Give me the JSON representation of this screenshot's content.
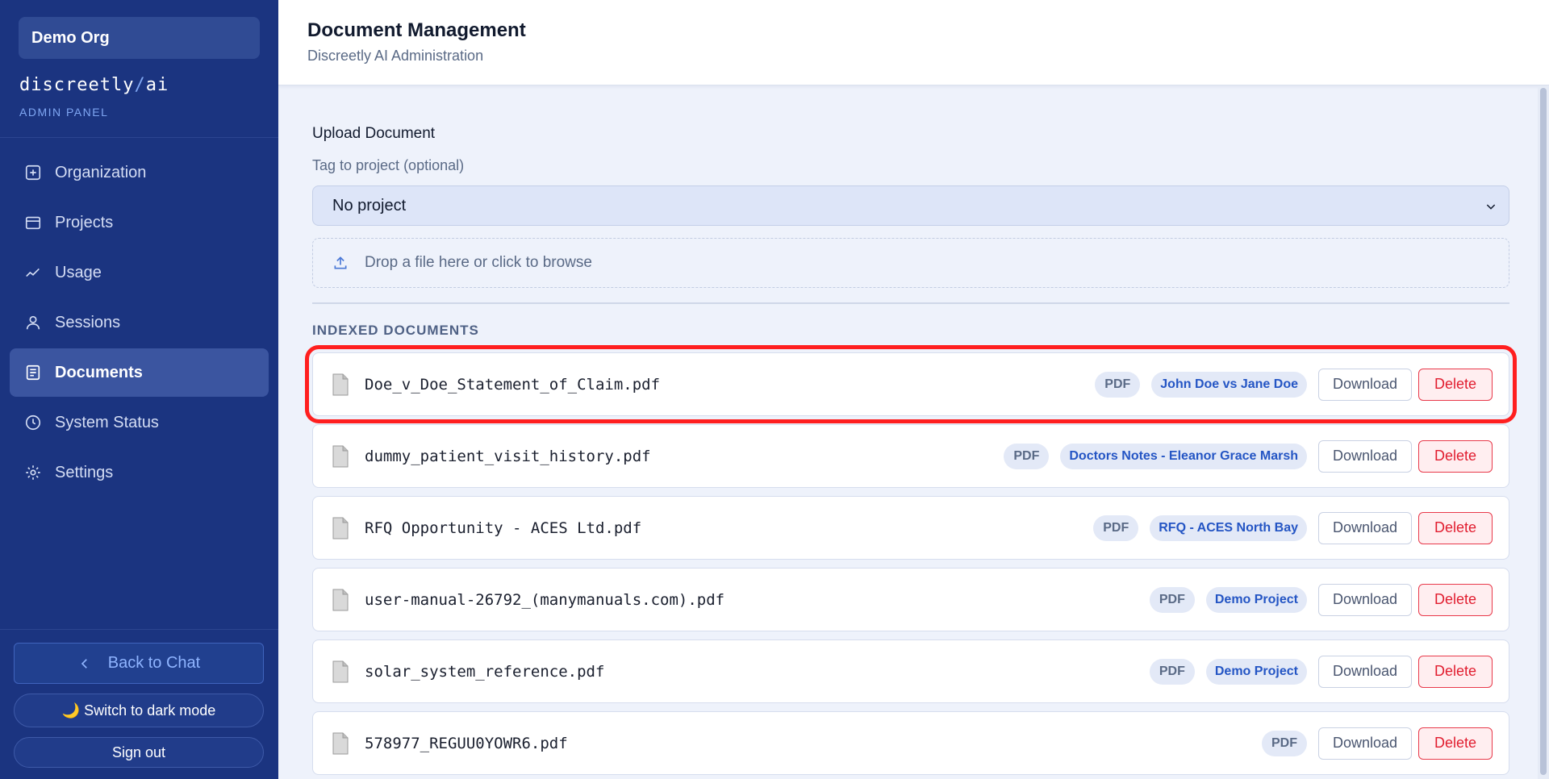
{
  "sidebar": {
    "org": "Demo Org",
    "brand_a": "discreetly",
    "brand_slash": "/",
    "brand_b": "ai",
    "brand_sub": "ADMIN PANEL",
    "nav": [
      {
        "label": "Organization",
        "icon": "plus-square-icon"
      },
      {
        "label": "Projects",
        "icon": "folder-icon"
      },
      {
        "label": "Usage",
        "icon": "chart-line-icon"
      },
      {
        "label": "Sessions",
        "icon": "user-icon"
      },
      {
        "label": "Documents",
        "icon": "document-icon",
        "active": true
      },
      {
        "label": "System Status",
        "icon": "clock-icon"
      },
      {
        "label": "Settings",
        "icon": "gear-icon"
      }
    ],
    "back_label": "Back to Chat",
    "dark_mode_label": "🌙 Switch to dark mode",
    "signout_label": "Sign out"
  },
  "header": {
    "title": "Document Management",
    "subtitle": "Discreetly AI Administration"
  },
  "upload": {
    "title": "Upload Document",
    "tag_label": "Tag to project (optional)",
    "selected_project": "No project",
    "dropzone_text": "Drop a file here or click to browse"
  },
  "indexed": {
    "label": "INDEXED DOCUMENTS",
    "documents": [
      {
        "name": "Doe_v_Doe_Statement_of_Claim.pdf",
        "type": "PDF",
        "project": "John Doe vs Jane Doe",
        "download": "Download",
        "delete": "Delete"
      },
      {
        "name": "dummy_patient_visit_history.pdf",
        "type": "PDF",
        "project": "Doctors Notes - Eleanor Grace Marsh",
        "download": "Download",
        "delete": "Delete"
      },
      {
        "name": "RFQ Opportunity - ACES Ltd.pdf",
        "type": "PDF",
        "project": "RFQ - ACES North Bay",
        "download": "Download",
        "delete": "Delete"
      },
      {
        "name": "user-manual-26792_(manymanuals.com).pdf",
        "type": "PDF",
        "project": "Demo Project",
        "download": "Download",
        "delete": "Delete"
      },
      {
        "name": "solar_system_reference.pdf",
        "type": "PDF",
        "project": "Demo Project",
        "download": "Download",
        "delete": "Delete"
      },
      {
        "name": "578977_REGUU0YOWR6.pdf",
        "type": "PDF",
        "project": "",
        "download": "Download",
        "delete": "Delete"
      }
    ]
  },
  "colors": {
    "sidebar_bg": "#1b3480",
    "accent": "#2455c4",
    "delete": "#e11d2f",
    "highlight": "#ff1f1f"
  }
}
